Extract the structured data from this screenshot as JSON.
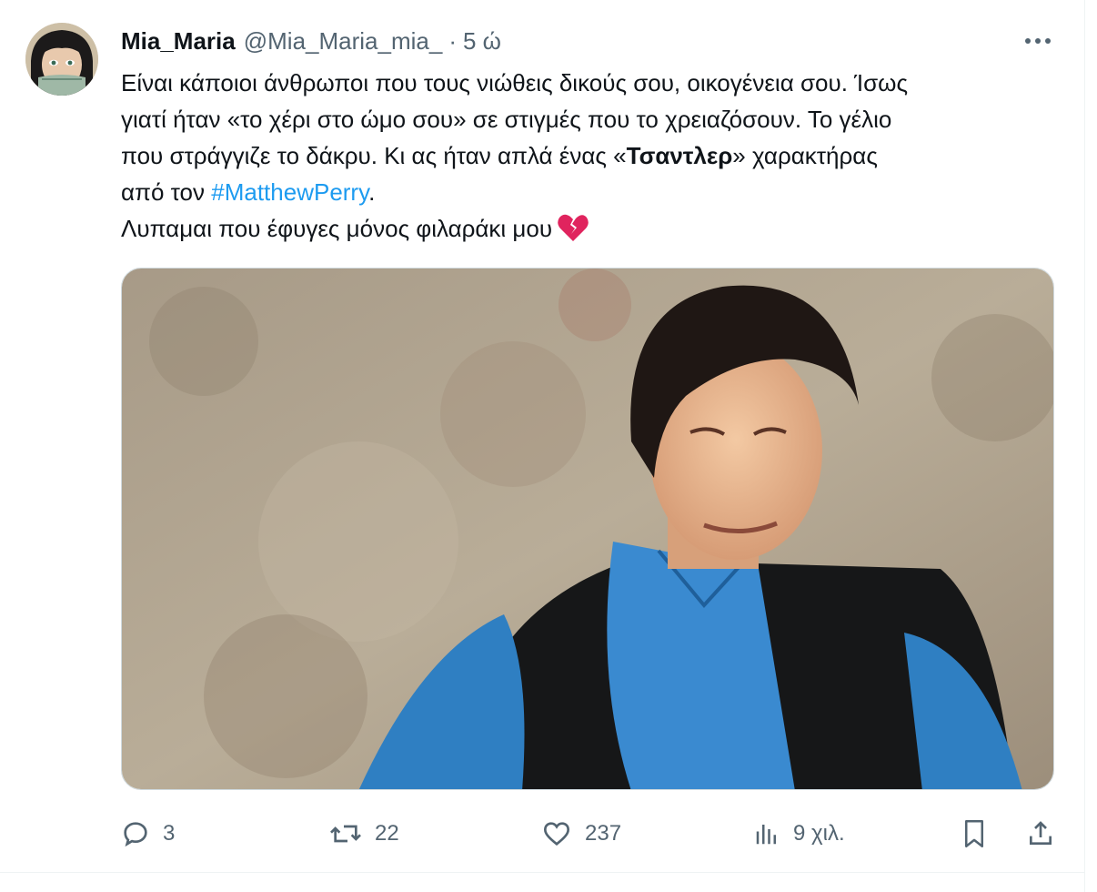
{
  "tweet": {
    "author": {
      "display_name": "Mia_Maria",
      "handle": "@Mia_Maria_mia_",
      "separator": "·",
      "time": "5 ώ"
    },
    "more_icon": "more-horizontal-icon",
    "text": {
      "line1": "Είναι κάποιοι άνθρωποι  που τους νιώθεις δικούς σου, οικογένεια σου. Ίσως",
      "line2": "γιατί ήταν «το χέρι στο ώμο σου» σε στιγμές που το χρειαζόσουν. Το γέλιο",
      "line3_before": "που στράγγιζε το δάκρυ. Κι ας ήταν απλά ένας «",
      "line3_bold": "Τσαντλερ",
      "line3_after": "» χαρακτήρας",
      "line4_before": "από τον ",
      "hashtag": "#MatthewPerry",
      "line4_after": ".",
      "line5": "Λυπαμαι που έφυγες μόνος φιλαράκι μου",
      "emoji": "broken-heart-icon"
    },
    "stats": {
      "replies": "3",
      "retweets": "22",
      "likes": "237",
      "views": "9 χιλ."
    },
    "icons": {
      "reply": "reply-icon",
      "retweet": "retweet-icon",
      "like": "heart-icon",
      "views": "views-chart-icon",
      "bookmark": "bookmark-icon",
      "share": "share-icon"
    },
    "colors": {
      "text": "#0f1419",
      "secondary": "#536471",
      "link": "#1d9bf0",
      "border": "#cfd9de"
    }
  }
}
